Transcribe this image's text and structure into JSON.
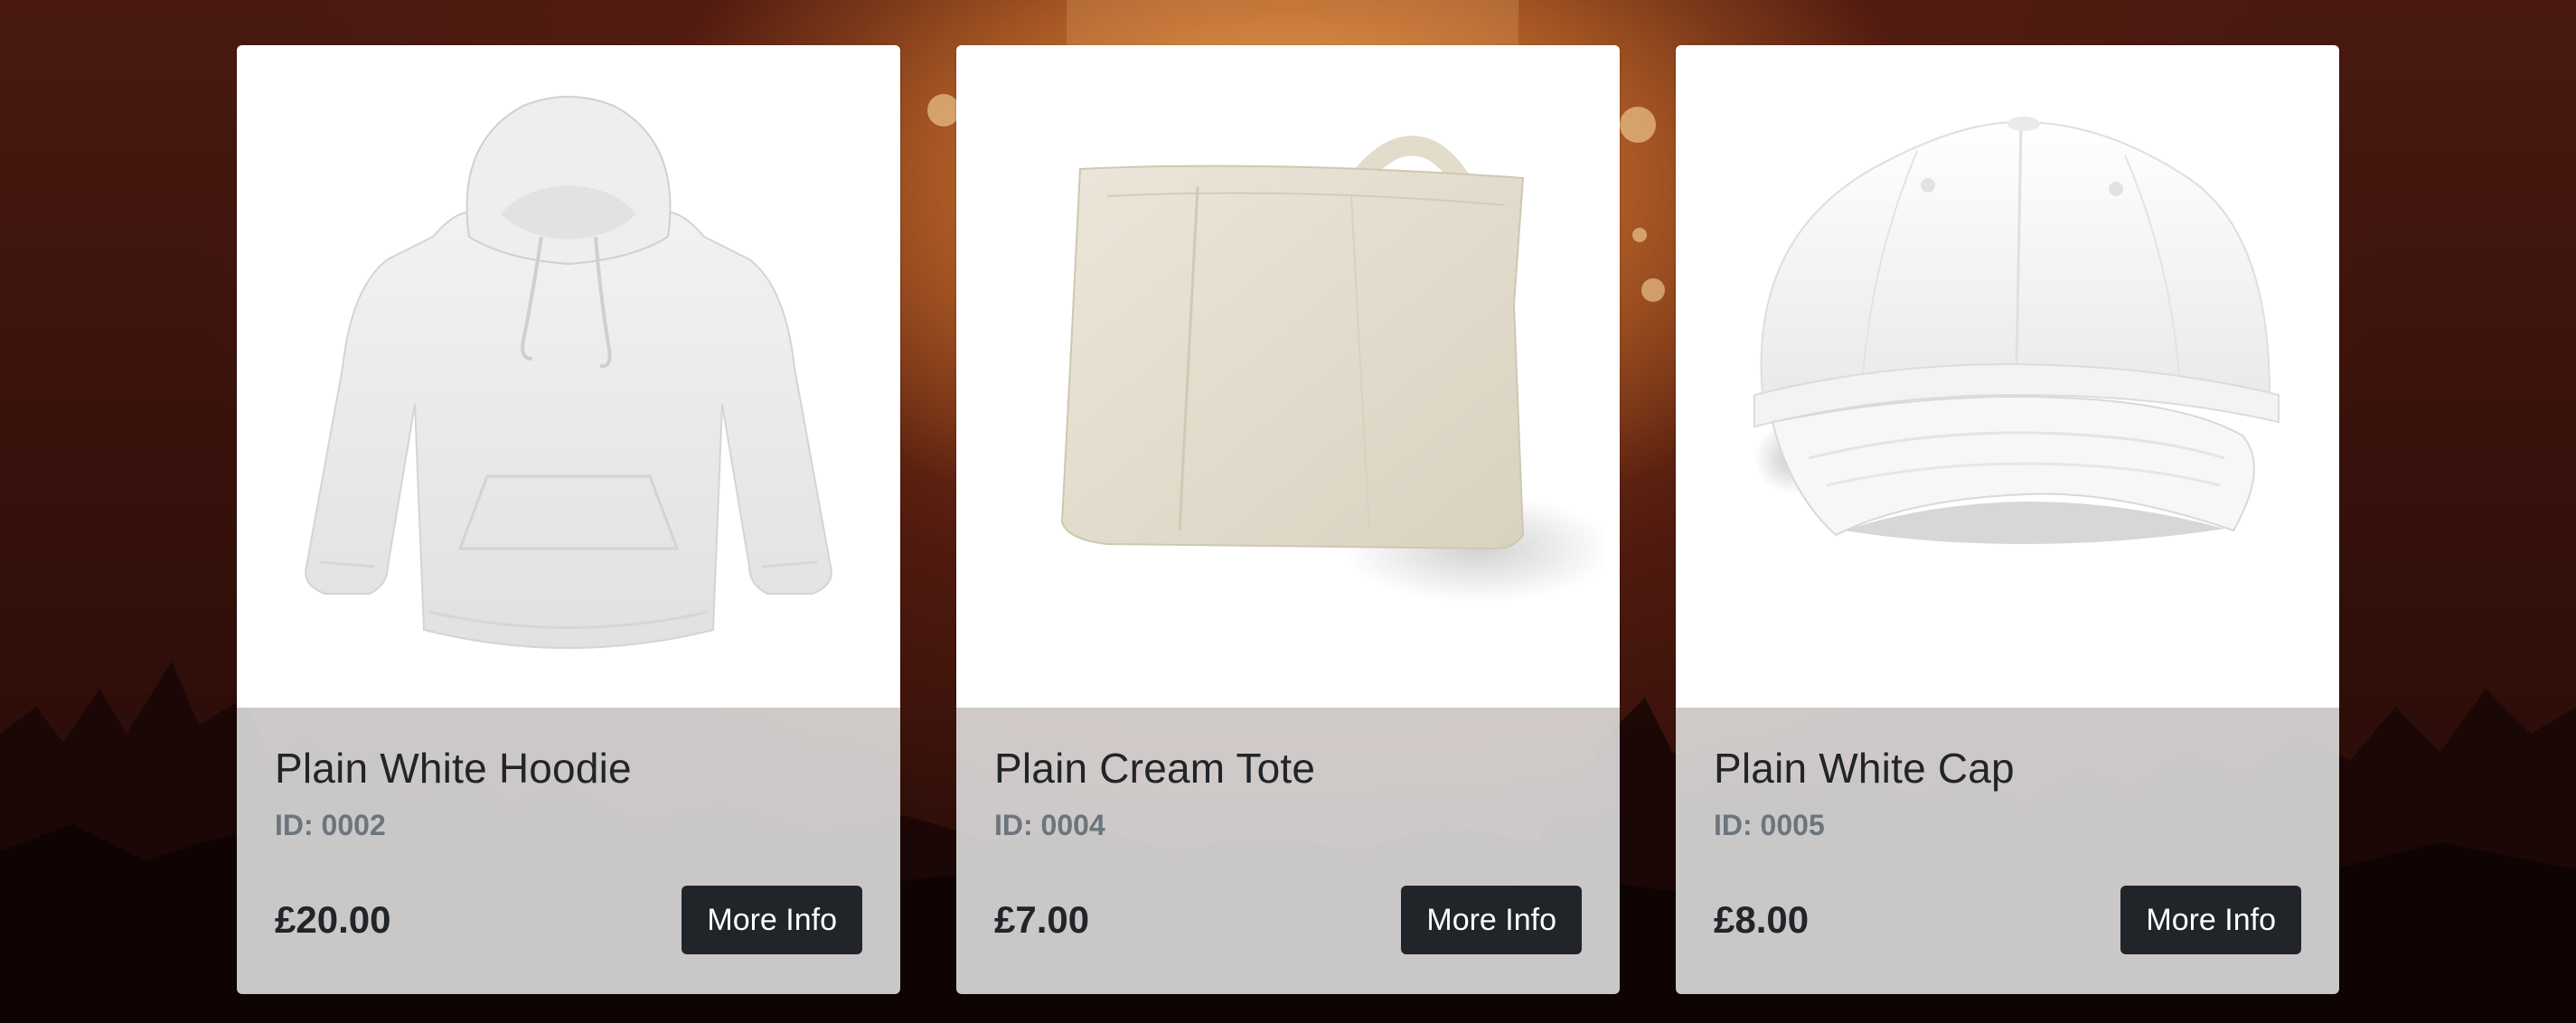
{
  "products": [
    {
      "title": "Plain White Hoodie",
      "id_label": "ID: 0002",
      "price": "£20.00",
      "button_label": "More Info",
      "image_icon": "hoodie-image"
    },
    {
      "title": "Plain Cream Tote",
      "id_label": "ID: 0004",
      "price": "£7.00",
      "button_label": "More Info",
      "image_icon": "tote-bag-image"
    },
    {
      "title": "Plain White Cap",
      "id_label": "ID: 0005",
      "price": "£8.00",
      "button_label": "More Info",
      "image_icon": "cap-image"
    }
  ],
  "colors": {
    "button_bg": "#212529",
    "button_text": "#ffffff",
    "card_body_bg": "#e8e8e8",
    "id_text": "#6c757d"
  }
}
